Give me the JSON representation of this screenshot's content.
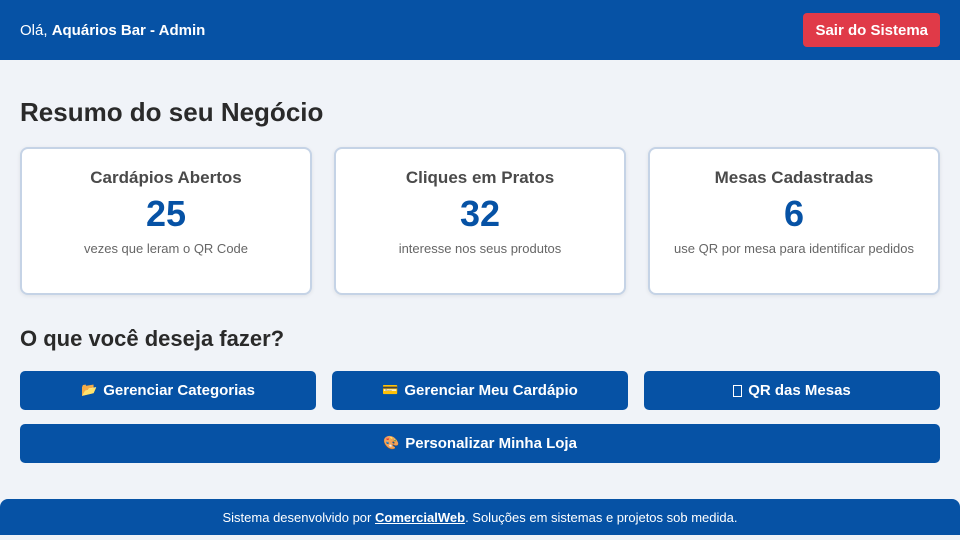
{
  "header": {
    "greeting_prefix": "Olá,",
    "user_name": "Aquários Bar - Admin",
    "logout_label": "Sair do Sistema"
  },
  "summary": {
    "title": "Resumo do seu Negócio",
    "cards": [
      {
        "title": "Cardápios Abertos",
        "value": "25",
        "description": "vezes que leram o QR Code"
      },
      {
        "title": "Cliques em Pratos",
        "value": "32",
        "description": "interesse nos seus produtos"
      },
      {
        "title": "Mesas Cadastradas",
        "value": "6",
        "description": "use QR por mesa para identificar pedidos"
      }
    ]
  },
  "actions": {
    "title": "O que você deseja fazer?",
    "buttons": [
      {
        "icon": "folder-icon",
        "label": "Gerenciar Categorias"
      },
      {
        "icon": "menu-card-icon",
        "label": "Gerenciar Meu Cardápio"
      },
      {
        "icon": "qr-box-icon",
        "label": "QR das Mesas"
      },
      {
        "icon": "palette-icon",
        "label": "Personalizar Minha Loja"
      }
    ]
  },
  "footer": {
    "prefix": "Sistema desenvolvido por",
    "link_label": "ComercialWeb",
    "suffix": ". Soluções em sistemas e projetos sob medida."
  },
  "colors": {
    "primary": "#0652a5",
    "danger": "#e03a48",
    "background": "#f0f3f8"
  }
}
